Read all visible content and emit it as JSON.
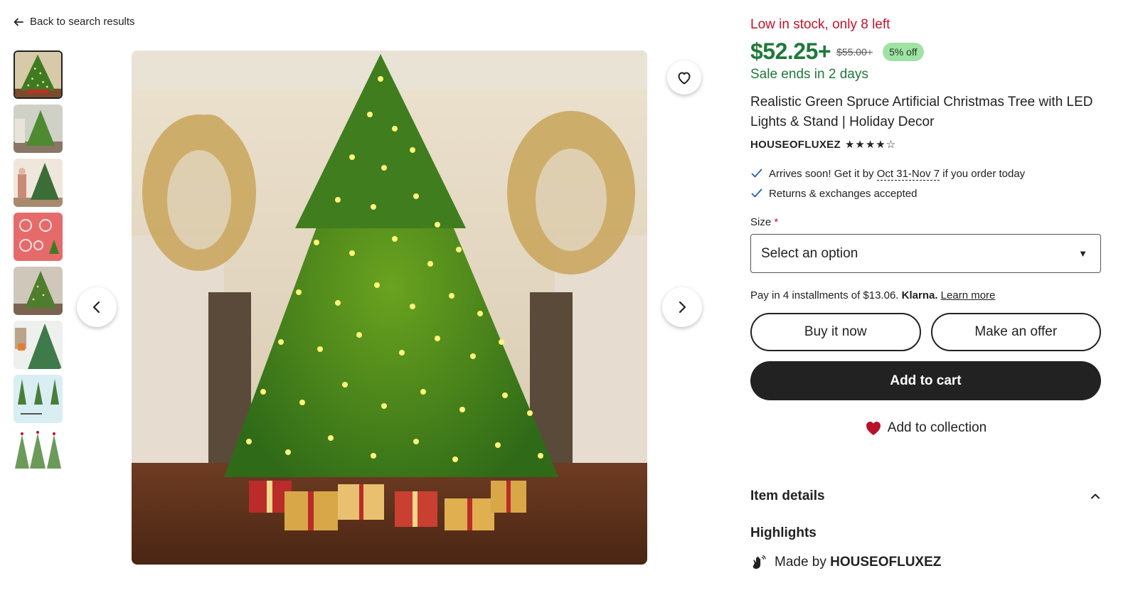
{
  "nav": {
    "back_label": "Back to search results"
  },
  "gallery": {
    "thumbnails": [
      {
        "name": "thumb-1",
        "theme": "tree-hall"
      },
      {
        "name": "thumb-2",
        "theme": "tree-room"
      },
      {
        "name": "thumb-3",
        "theme": "tree-people"
      },
      {
        "name": "thumb-4",
        "theme": "parts-red"
      },
      {
        "name": "thumb-5",
        "theme": "tree-room-2"
      },
      {
        "name": "thumb-6",
        "theme": "closeup"
      },
      {
        "name": "thumb-7",
        "theme": "sizes-blue"
      },
      {
        "name": "thumb-8",
        "theme": "three-trees"
      }
    ],
    "active_index": 0
  },
  "product": {
    "stock": "Low in stock, only 8 left",
    "price": "$52.25+",
    "original_price": "$55.00+",
    "discount": "5% off",
    "sale_ends": "Sale ends in 2 days",
    "title": "Realistic Green Spruce Artificial Christmas Tree with LED Lights & Stand | Holiday Decor",
    "seller": "HOUSEOFLUXEZ",
    "rating_stars": "★★★★☆",
    "arrival_prefix": "Arrives soon! Get it by ",
    "arrival_dates": "Oct 31-Nov 7",
    "arrival_suffix": " if you order today",
    "returns": "Returns & exchanges accepted",
    "size_label": "Size",
    "size_required": "*",
    "size_placeholder": "Select an option",
    "klarna_text": "Pay in 4 installments of $13.06.",
    "klarna_brand": "Klarna.",
    "klarna_link": "Learn more",
    "buy_now": "Buy it now",
    "make_offer": "Make an offer",
    "add_to_cart": "Add to cart",
    "add_collection": "Add to collection",
    "item_details": "Item details",
    "highlights": "Highlights",
    "made_by_prefix": "Made by ",
    "made_by": "HOUSEOFLUXEZ"
  },
  "colors": {
    "stock_red": "#c4132b",
    "price_green": "#1e7a3a",
    "badge_green": "#9fe2a3",
    "button_dark": "#222222"
  }
}
